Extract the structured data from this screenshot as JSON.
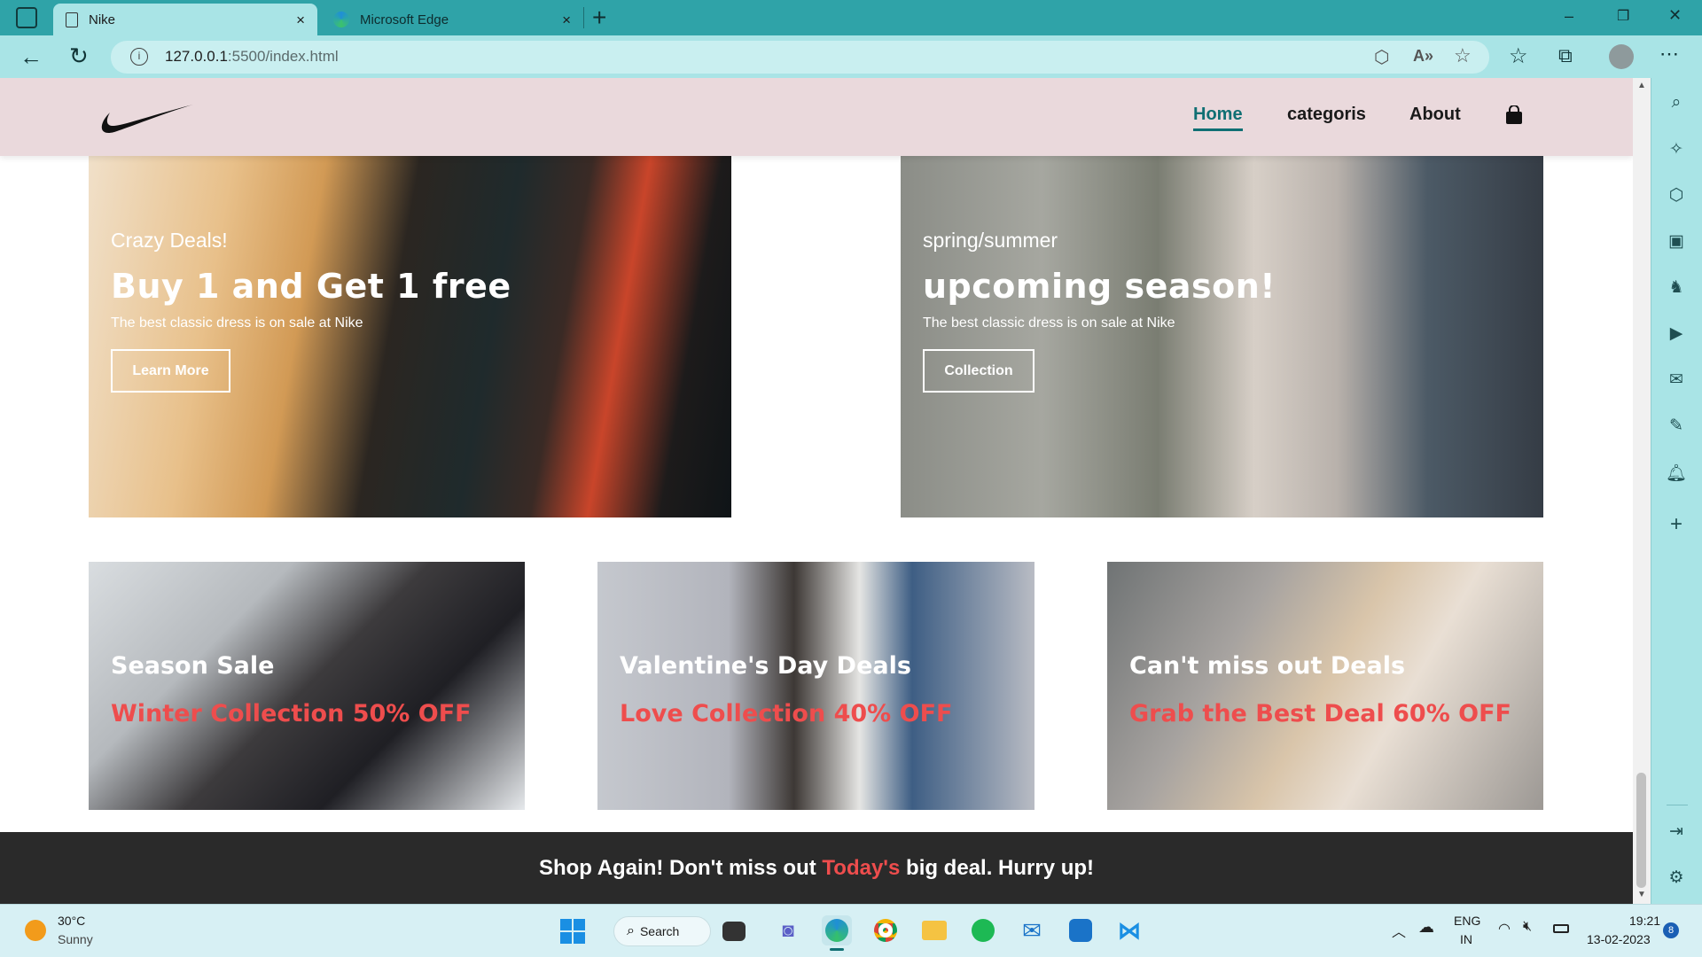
{
  "browser": {
    "tabs": [
      {
        "title": "Nike"
      },
      {
        "title": "Microsoft Edge"
      }
    ],
    "new_tab": "+",
    "close_glyph": "×",
    "url_host": "127.0.0.1",
    "url_path": ":5500/index.html",
    "window_controls": {
      "minimize": "–",
      "restore": "❐",
      "close": "✕"
    }
  },
  "site": {
    "nav": {
      "links": [
        "Home",
        "categoris",
        "About"
      ],
      "active": "Home"
    },
    "hero_cards": [
      {
        "kicker": "Crazy Deals!",
        "title": "Buy 1 and Get 1 free",
        "subtitle": "The best classic dress is on sale at Nike",
        "button": "Learn More"
      },
      {
        "kicker": "spring/summer",
        "title": "upcoming season!",
        "subtitle": "The best classic dress is on sale at Nike",
        "button": "Collection"
      }
    ],
    "small_cards": [
      {
        "title": "Season Sale",
        "subtitle": "Winter Collection 50% OFF"
      },
      {
        "title": "Valentine's Day Deals",
        "subtitle": "Love Collection 40% OFF"
      },
      {
        "title": "Can't miss out Deals",
        "subtitle": "Grab the Best Deal 60% OFF"
      }
    ],
    "footer": {
      "part1": "Shop Again! Don't miss out ",
      "highlight": "Today's",
      "part2": " big deal. Hurry up!"
    }
  },
  "taskbar": {
    "weather_temp": "30°C",
    "weather_desc": "Sunny",
    "search_label": "Search",
    "lang": "ENG",
    "region": "IN",
    "time": "19:21",
    "date": "13-02-2023",
    "notification_count": "8"
  },
  "colors": {
    "accent": "#0f6f73",
    "sale_red": "#ee4d4d",
    "nav_bg": "#ead9dc",
    "footer_bg": "#2a2a2a",
    "browser_frame": "#2fa3a8"
  }
}
